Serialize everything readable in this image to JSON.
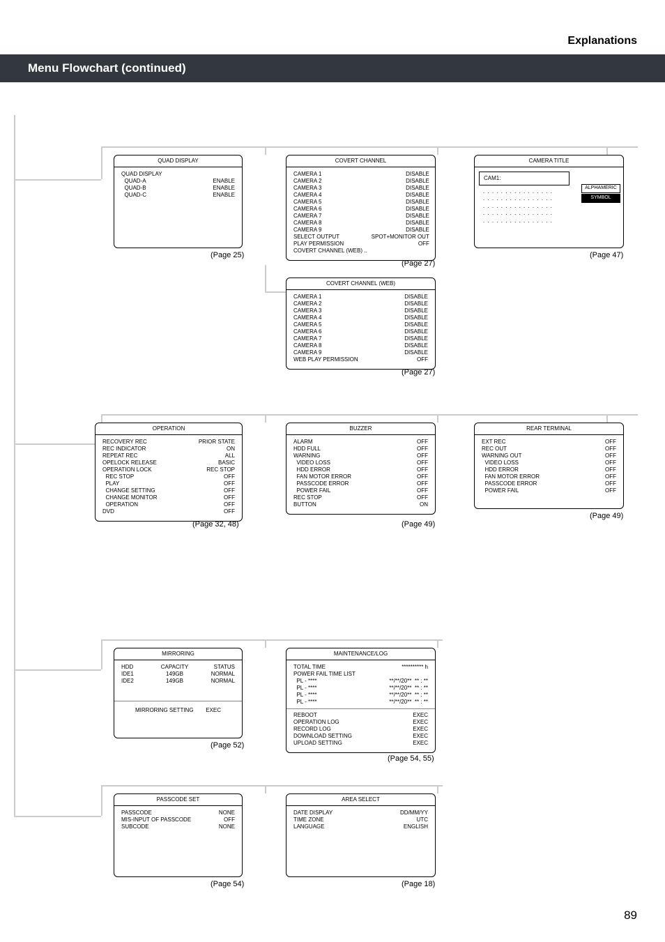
{
  "header": {
    "section": "Explanations",
    "title": "Menu Flowchart (continued)"
  },
  "page_number": "89",
  "boxes": {
    "quad_display": {
      "title": "QUAD DISPLAY",
      "left": "QUAD DISPLAY\n  QUAD-A\n  QUAD-B\n  QUAD-C",
      "right": "\nENABLE\nENABLE\nENABLE",
      "page_ref": "(Page 25)"
    },
    "covert_channel": {
      "title": "COVERT CHANNEL",
      "left": "CAMERA 1\nCAMERA 2\nCAMERA 3\nCAMERA 4\nCAMERA 5\nCAMERA 6\nCAMERA 7\nCAMERA 8\nCAMERA 9\nSELECT OUTPUT\nPLAY PERMISSION\nCOVERT CHANNEL (WEB) ..",
      "right": "DISABLE\nDISABLE\nDISABLE\nDISABLE\nDISABLE\nDISABLE\nDISABLE\nDISABLE\nDISABLE\nSPOT+MONITOR OUT\nOFF\n ",
      "page_ref": "(Page 27)"
    },
    "camera_title": {
      "title": "CAMERA TITLE",
      "cam_label": "CAM1:",
      "dots": ". . . . . . . . . . . . . . . .\n. . . . . . . . . . . . . . . .\n. . . . . . . . . . . . . . . .\n. . . . . . . . . . . . . . . .\n. . . . . . . . . . . . . . . .",
      "btn1": "ALPHAMERIC",
      "btn2": "SYMBOL",
      "page_ref": "(Page 47)"
    },
    "covert_channel_web": {
      "title": "COVERT CHANNEL (WEB)",
      "left": "CAMERA 1\nCAMERA 2\nCAMERA 3\nCAMERA 4\nCAMERA 5\nCAMERA 6\nCAMERA 7\nCAMERA 8\nCAMERA 9\nWEB PLAY PERMISSION",
      "right": "DISABLE\nDISABLE\nDISABLE\nDISABLE\nDISABLE\nDISABLE\nDISABLE\nDISABLE\nDISABLE\nOFF",
      "page_ref": "(Page 27)"
    },
    "operation": {
      "title": "OPERATION",
      "left": "RECOVERY REC\nREC INDICATOR\nREPEAT REC\nOPELOCK RELEASE\nOPERATION LOCK\n  REC STOP\n  PLAY\n  CHANGE SETTING\n  CHANGE MONITOR\n  OPERATION\nDVD",
      "right": "PRIOR STATE\nON\nALL\nBASIC\nREC STOP\nOFF\nOFF\nOFF\nOFF\nOFF\nOFF",
      "page_ref": "(Page 32, 48)"
    },
    "buzzer": {
      "title": "BUZZER",
      "left": "ALARM\nHDD FULL\nWARNING\n  VIDEO LOSS\n  HDD ERROR\n  FAN MOTOR ERROR\n  PASSCODE ERROR\n  POWER FAIL\nREC STOP\nBUTTON",
      "right": "OFF\nOFF\nOFF\nOFF\nOFF\nOFF\nOFF\nOFF\nOFF\nON",
      "page_ref": "(Page 49)"
    },
    "rear_terminal": {
      "title": "REAR TERMINAL",
      "left": "EXT REC\nREC OUT\nWARNING OUT\n  VIDEO LOSS\n  HDD ERROR\n  FAN MOTOR ERROR\n  PASSCODE ERROR\n  POWER FAIL",
      "right": "OFF\nOFF\nOFF\nOFF\nOFF\nOFF\nOFF\nOFF",
      "page_ref": "(Page 49)"
    },
    "mirroring": {
      "title": "MIRRORING",
      "h1": "HDD",
      "h2": "CAPACITY",
      "h3": "STATUS",
      "r1c1": "IDE1",
      "r1c2": "149GB",
      "r1c3": "NORMAL",
      "r2c1": "IDE2",
      "r2c2": "149GB",
      "r2c3": "NORMAL",
      "setting_l": "MIRRORING SETTING",
      "setting_r": "EXEC",
      "page_ref": "(Page 52)"
    },
    "maintenance_log": {
      "title": "MAINTENANCE/LOG",
      "left": "TOTAL TIME\nPOWER FAIL TIME LIST\n  PL - ****\n  PL - ****\n  PL - ****\n  PL - ****",
      "right": "********** h\n \n**/**/20**  ** : **\n**/**/20**  ** : **\n**/**/20**  ** : **\n**/**/20**  ** : **",
      "left2": "REBOOT\nOPERATION LOG\nRECORD LOG\nDOWNLOAD SETTING\nUPLOAD SETTING",
      "right2": "EXEC\nEXEC\nEXEC\nEXEC\nEXEC",
      "page_ref": "(Page 54, 55)"
    },
    "passcode_set": {
      "title": "PASSCODE SET",
      "left": "PASSCODE\nMIS-INPUT OF PASSCODE\nSUBCODE",
      "right": "NONE\nOFF\nNONE",
      "page_ref": "(Page 54)"
    },
    "area_select": {
      "title": "AREA SELECT",
      "left": "DATE DISPLAY\nTIME ZONE\nLANGUAGE",
      "right": "DD/MM/YY\nUTC\nENGLISH",
      "page_ref": "(Page 18)"
    }
  }
}
